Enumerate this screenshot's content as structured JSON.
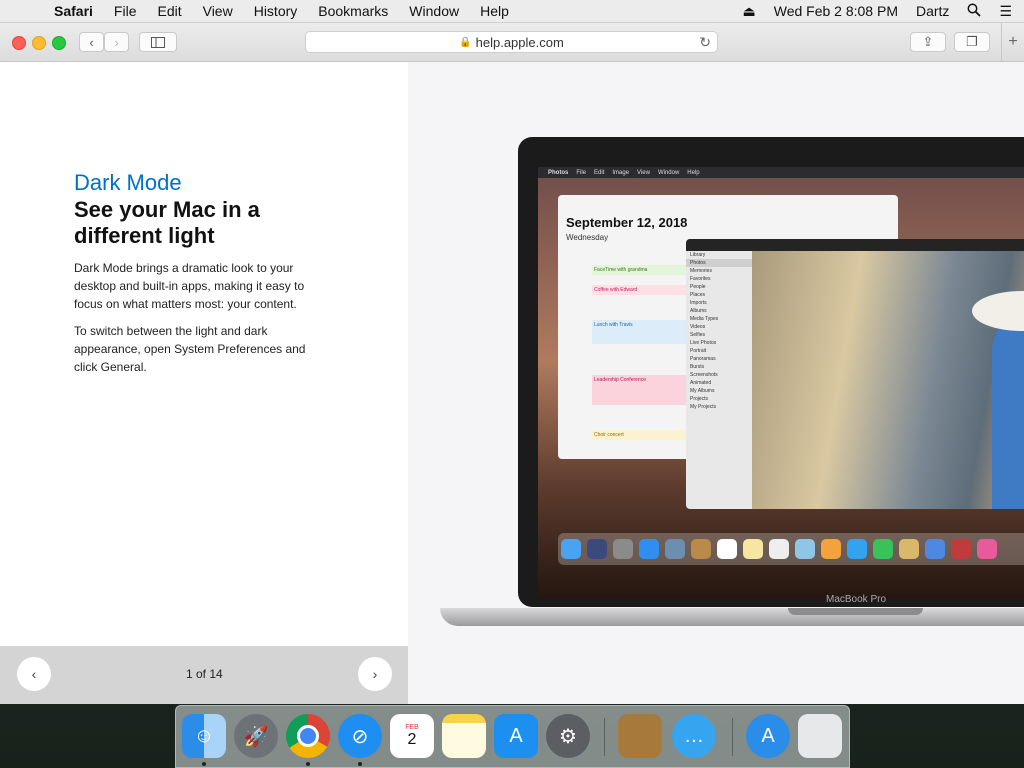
{
  "menubar": {
    "app_name": "Safari",
    "items": [
      "File",
      "Edit",
      "View",
      "History",
      "Bookmarks",
      "Window",
      "Help"
    ],
    "datetime": "Wed Feb 2  8:08 PM",
    "user": "Dartz"
  },
  "browser": {
    "url": "help.apple.com"
  },
  "article": {
    "kicker": "Dark Mode",
    "headline": "See your Mac in a different light",
    "paragraph1": "Dark Mode brings a dramatic look to your desktop and built-in apps, making it easy to focus on what matters most: your content.",
    "paragraph2": "To switch between the light and dark appearance, open System Preferences and click General."
  },
  "pager": {
    "count": "1 of 14",
    "prev_icon": "chevron-left-icon",
    "next_icon": "chevron-right-icon"
  },
  "illustration": {
    "device_label": "MacBook Pro",
    "screen_menubar": [
      "Photos",
      "File",
      "Edit",
      "Image",
      "View",
      "Window",
      "Help"
    ],
    "calendar_title": "September 12, 2018",
    "calendar_day": "Wednesday",
    "events": [
      "FaceTime with grandma",
      "Coffee with Edward",
      "Lunch with Travis",
      "Leadership Conference",
      "Choir concert"
    ],
    "photos_sidebar": [
      "Library",
      "Photos",
      "Memories",
      "Favorites",
      "People",
      "Places",
      "Imports",
      "Albums",
      "Media Types",
      "Videos",
      "Selfies",
      "Live Photos",
      "Portrait",
      "Panoramas",
      "Bursts",
      "Screenshots",
      "Animated",
      "My Albums",
      "Projects",
      "My Projects"
    ]
  },
  "dock": {
    "apps": [
      "Finder",
      "Launchpad",
      "Chrome",
      "Safari",
      "Calendar",
      "Notes",
      "App Store",
      "System Preferences",
      "Archive",
      "Messages",
      "Downloads",
      "Trash"
    ],
    "calendar_month": "FEB",
    "calendar_day": "2"
  }
}
